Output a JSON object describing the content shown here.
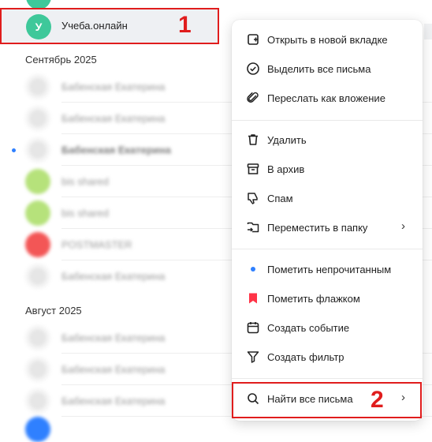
{
  "list": {
    "first_sender_initial": "У",
    "first_sender_name": "Учеба.онлайн",
    "section_september": "Сентябрь 2025",
    "section_august": "Август 2025",
    "rows": [
      {
        "name": "Бабенская Екатерина"
      },
      {
        "name": "Бабенская Екатерина"
      },
      {
        "name": "Бабенская Екатерина"
      },
      {
        "name": "bis shared"
      },
      {
        "name": "bis shared"
      },
      {
        "name": "POSTMASTER"
      },
      {
        "name": "Бабенская Екатерина"
      },
      {
        "name": "Бабенская Екатерина"
      },
      {
        "name": "Бабенская Екатерина"
      },
      {
        "name": "Бабенская Екатерина"
      }
    ]
  },
  "context_menu": {
    "open_new_tab": "Открыть в новой вкладке",
    "select_all": "Выделить все письма",
    "forward_attachment": "Переслать как вложение",
    "delete": "Удалить",
    "archive": "В архив",
    "spam": "Спам",
    "move_to_folder": "Переместить в папку",
    "mark_unread": "Пометить непрочитанным",
    "mark_flag": "Пометить флажком",
    "create_event": "Создать событие",
    "create_filter": "Создать фильтр",
    "find_all": "Найти все письма",
    "chevron": "›"
  },
  "annotations": {
    "first": "1",
    "second": "2"
  },
  "colors": {
    "accent_green": "#3ec89a",
    "flag_red": "#ff3347",
    "unread_blue": "#2f80ff",
    "annotation_red": "#e01d1d"
  }
}
